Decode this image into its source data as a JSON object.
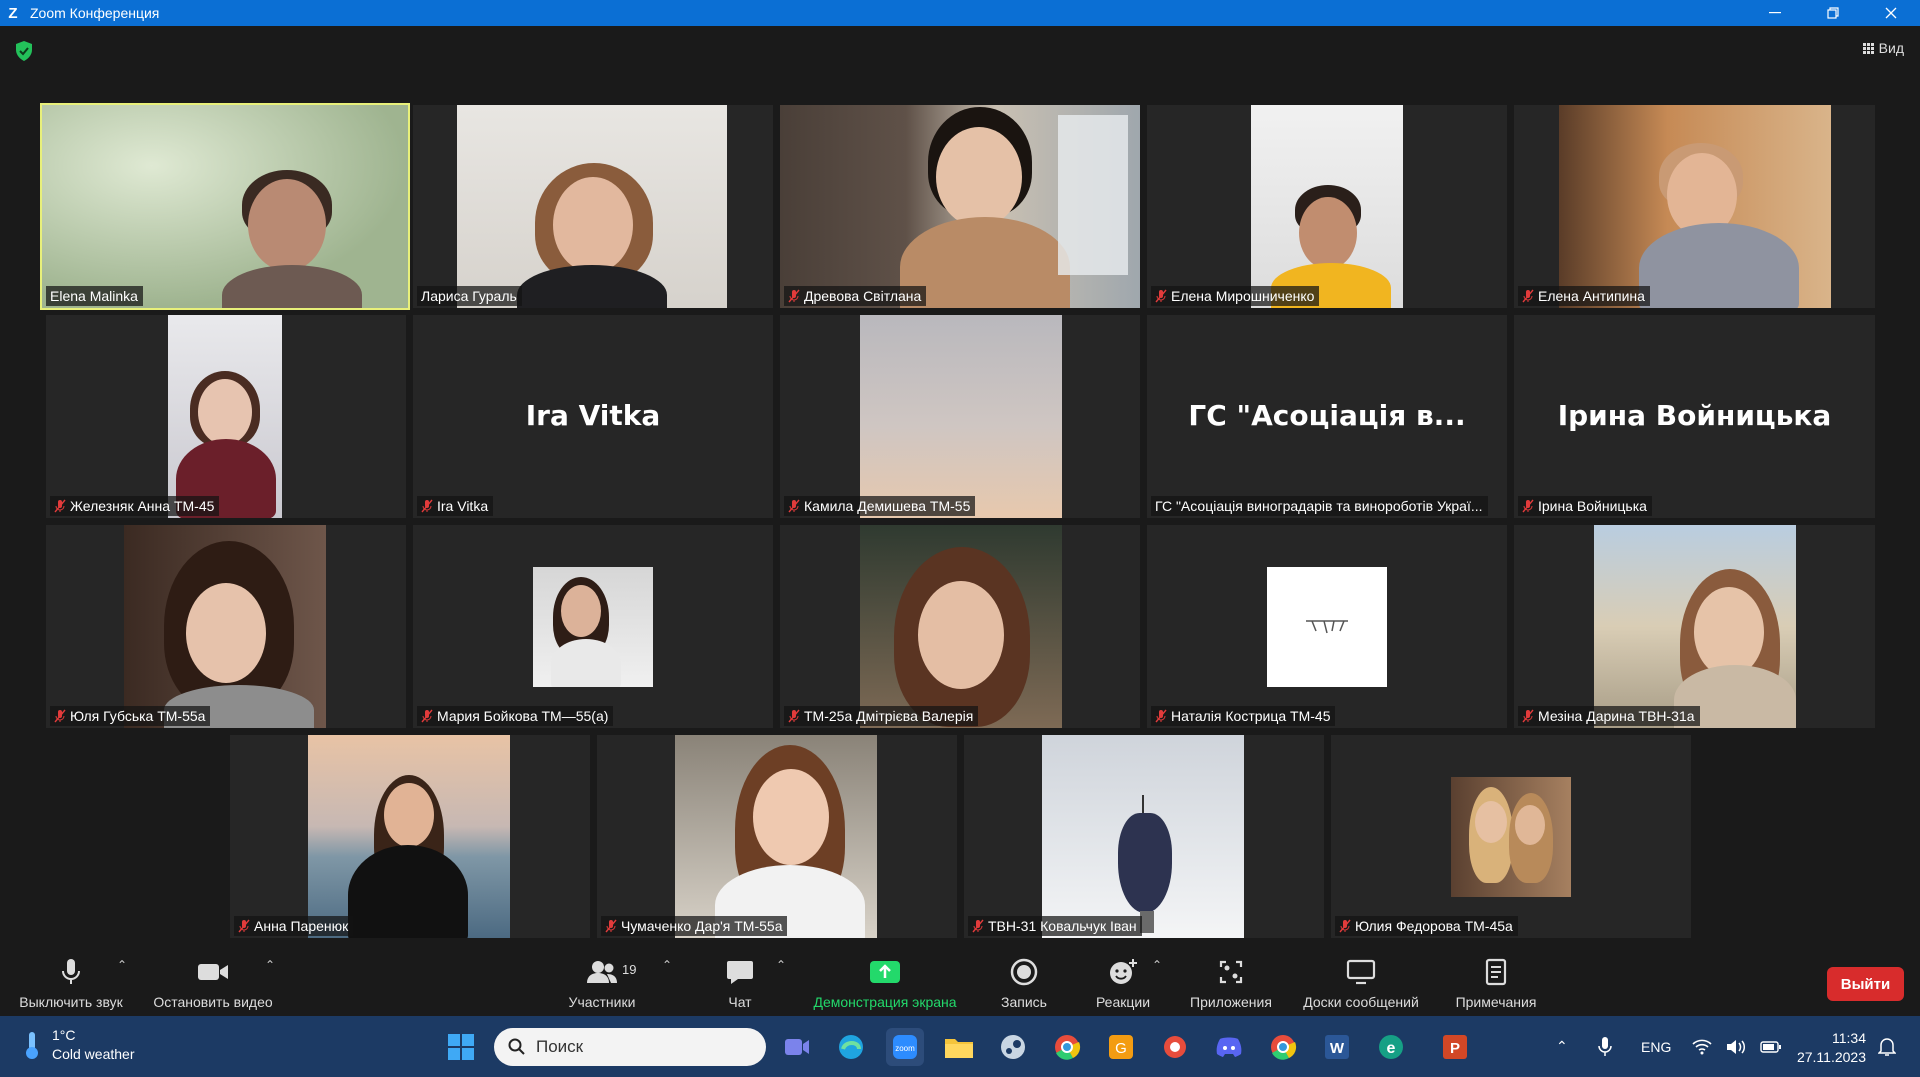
{
  "window": {
    "title": "Zoom Конференция",
    "app_letter": "Z"
  },
  "view_label": "Вид",
  "participants": [
    {
      "name": "Elena Malinka"
    },
    {
      "name": "Лариса Гураль"
    },
    {
      "name": "Древова Світлана"
    },
    {
      "name": "Елена Мирошниченко"
    },
    {
      "name": "Елена Антипина"
    },
    {
      "name": "Железняк Анна ТМ-45"
    },
    {
      "name": "Ira Vitka",
      "display": "Ira Vitka"
    },
    {
      "name": "Камила Демишева ТМ-55"
    },
    {
      "name": "ГС \"Асоціація виноградарів та винороботів Украї...",
      "display": "ГС  \"Асоціація в..."
    },
    {
      "name": "Ірина Войницька",
      "display": "Ірина Войницька"
    },
    {
      "name": "Юля Губська ТМ-55а"
    },
    {
      "name": "Мария Бойкова ТМ—55(а)"
    },
    {
      "name": "ТМ-25а Дмітрієва Валерія"
    },
    {
      "name": "Наталія Кострица ТМ-45"
    },
    {
      "name": "Мезіна Дарина ТВН-31а"
    },
    {
      "name": "Анна Паренюк"
    },
    {
      "name": "Чумаченко Дар'я ТМ-55а"
    },
    {
      "name": "ТВН-31 Ковальчук Іван"
    },
    {
      "name": "Юлия Федорова ТМ-45а"
    }
  ],
  "toolbar": {
    "mute": "Выключить звук",
    "video": "Остановить видео",
    "participants": "Участники",
    "participants_count": "19",
    "chat": "Чат",
    "share": "Демонстрация экрана",
    "record": "Запись",
    "reactions": "Реакции",
    "apps": "Приложения",
    "whiteboards": "Доски сообщений",
    "notes": "Примечания",
    "leave": "Выйти"
  },
  "taskbar": {
    "temperature": "1°C",
    "weather": "Cold weather",
    "search_placeholder": "Поиск",
    "language": "ENG",
    "time": "11:34",
    "date": "27.11.2023"
  },
  "colors": {
    "titlebar": "#0b6fd4",
    "active_speaker": "#e8f07a",
    "share_green": "#23d96b",
    "leave_red": "#d82c2c",
    "taskbar": "#1c3a64"
  }
}
